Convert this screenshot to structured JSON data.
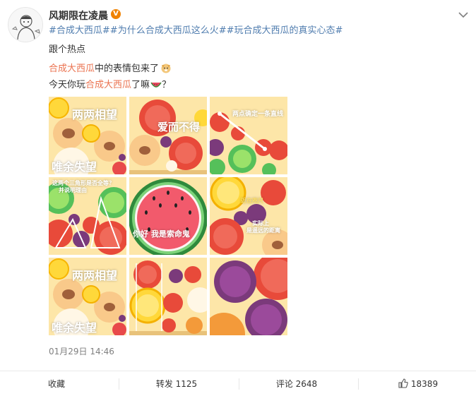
{
  "user": {
    "name": "风期限在凌晨",
    "verified_badge": "V"
  },
  "post": {
    "tags_line": [
      "#合成大西瓜#",
      "#为什么合成大西瓜这么火#",
      "#玩合成大西瓜的真实心态#"
    ],
    "line2": "跟个热点",
    "line3_prefix": "合成大西瓜",
    "line3_suffix": "中的表情包来了",
    "line4_prefix": "今天你玩",
    "line4_hl": "合成大西瓜",
    "line4_suffix": "了嘛",
    "line4_end": "？",
    "timestamp": "01月29日 14:46"
  },
  "images": {
    "c1_top": "两两相望",
    "c1_bottom": "唯余失望",
    "c2": "爱而不得",
    "c3": "两点确定一条直线",
    "c4_a": "这两个三角形是否全等？",
    "c4_b": "并说明理由",
    "c5": "你好 我是索命鬼",
    "c6_a": "近在咫尺",
    "c6_b": "实际上",
    "c6_c": "是遥远的距离",
    "c7_top": "两两相望",
    "c7_bottom": "唯余失望"
  },
  "actions": {
    "favorite": "收藏",
    "repost": "转发 1125",
    "comment": "评论 2648",
    "like": "18389"
  },
  "colors": {
    "link": "#507daf",
    "highlight": "#eb7350",
    "badge": "#f08200",
    "bg_tile": "#fde6a8"
  }
}
